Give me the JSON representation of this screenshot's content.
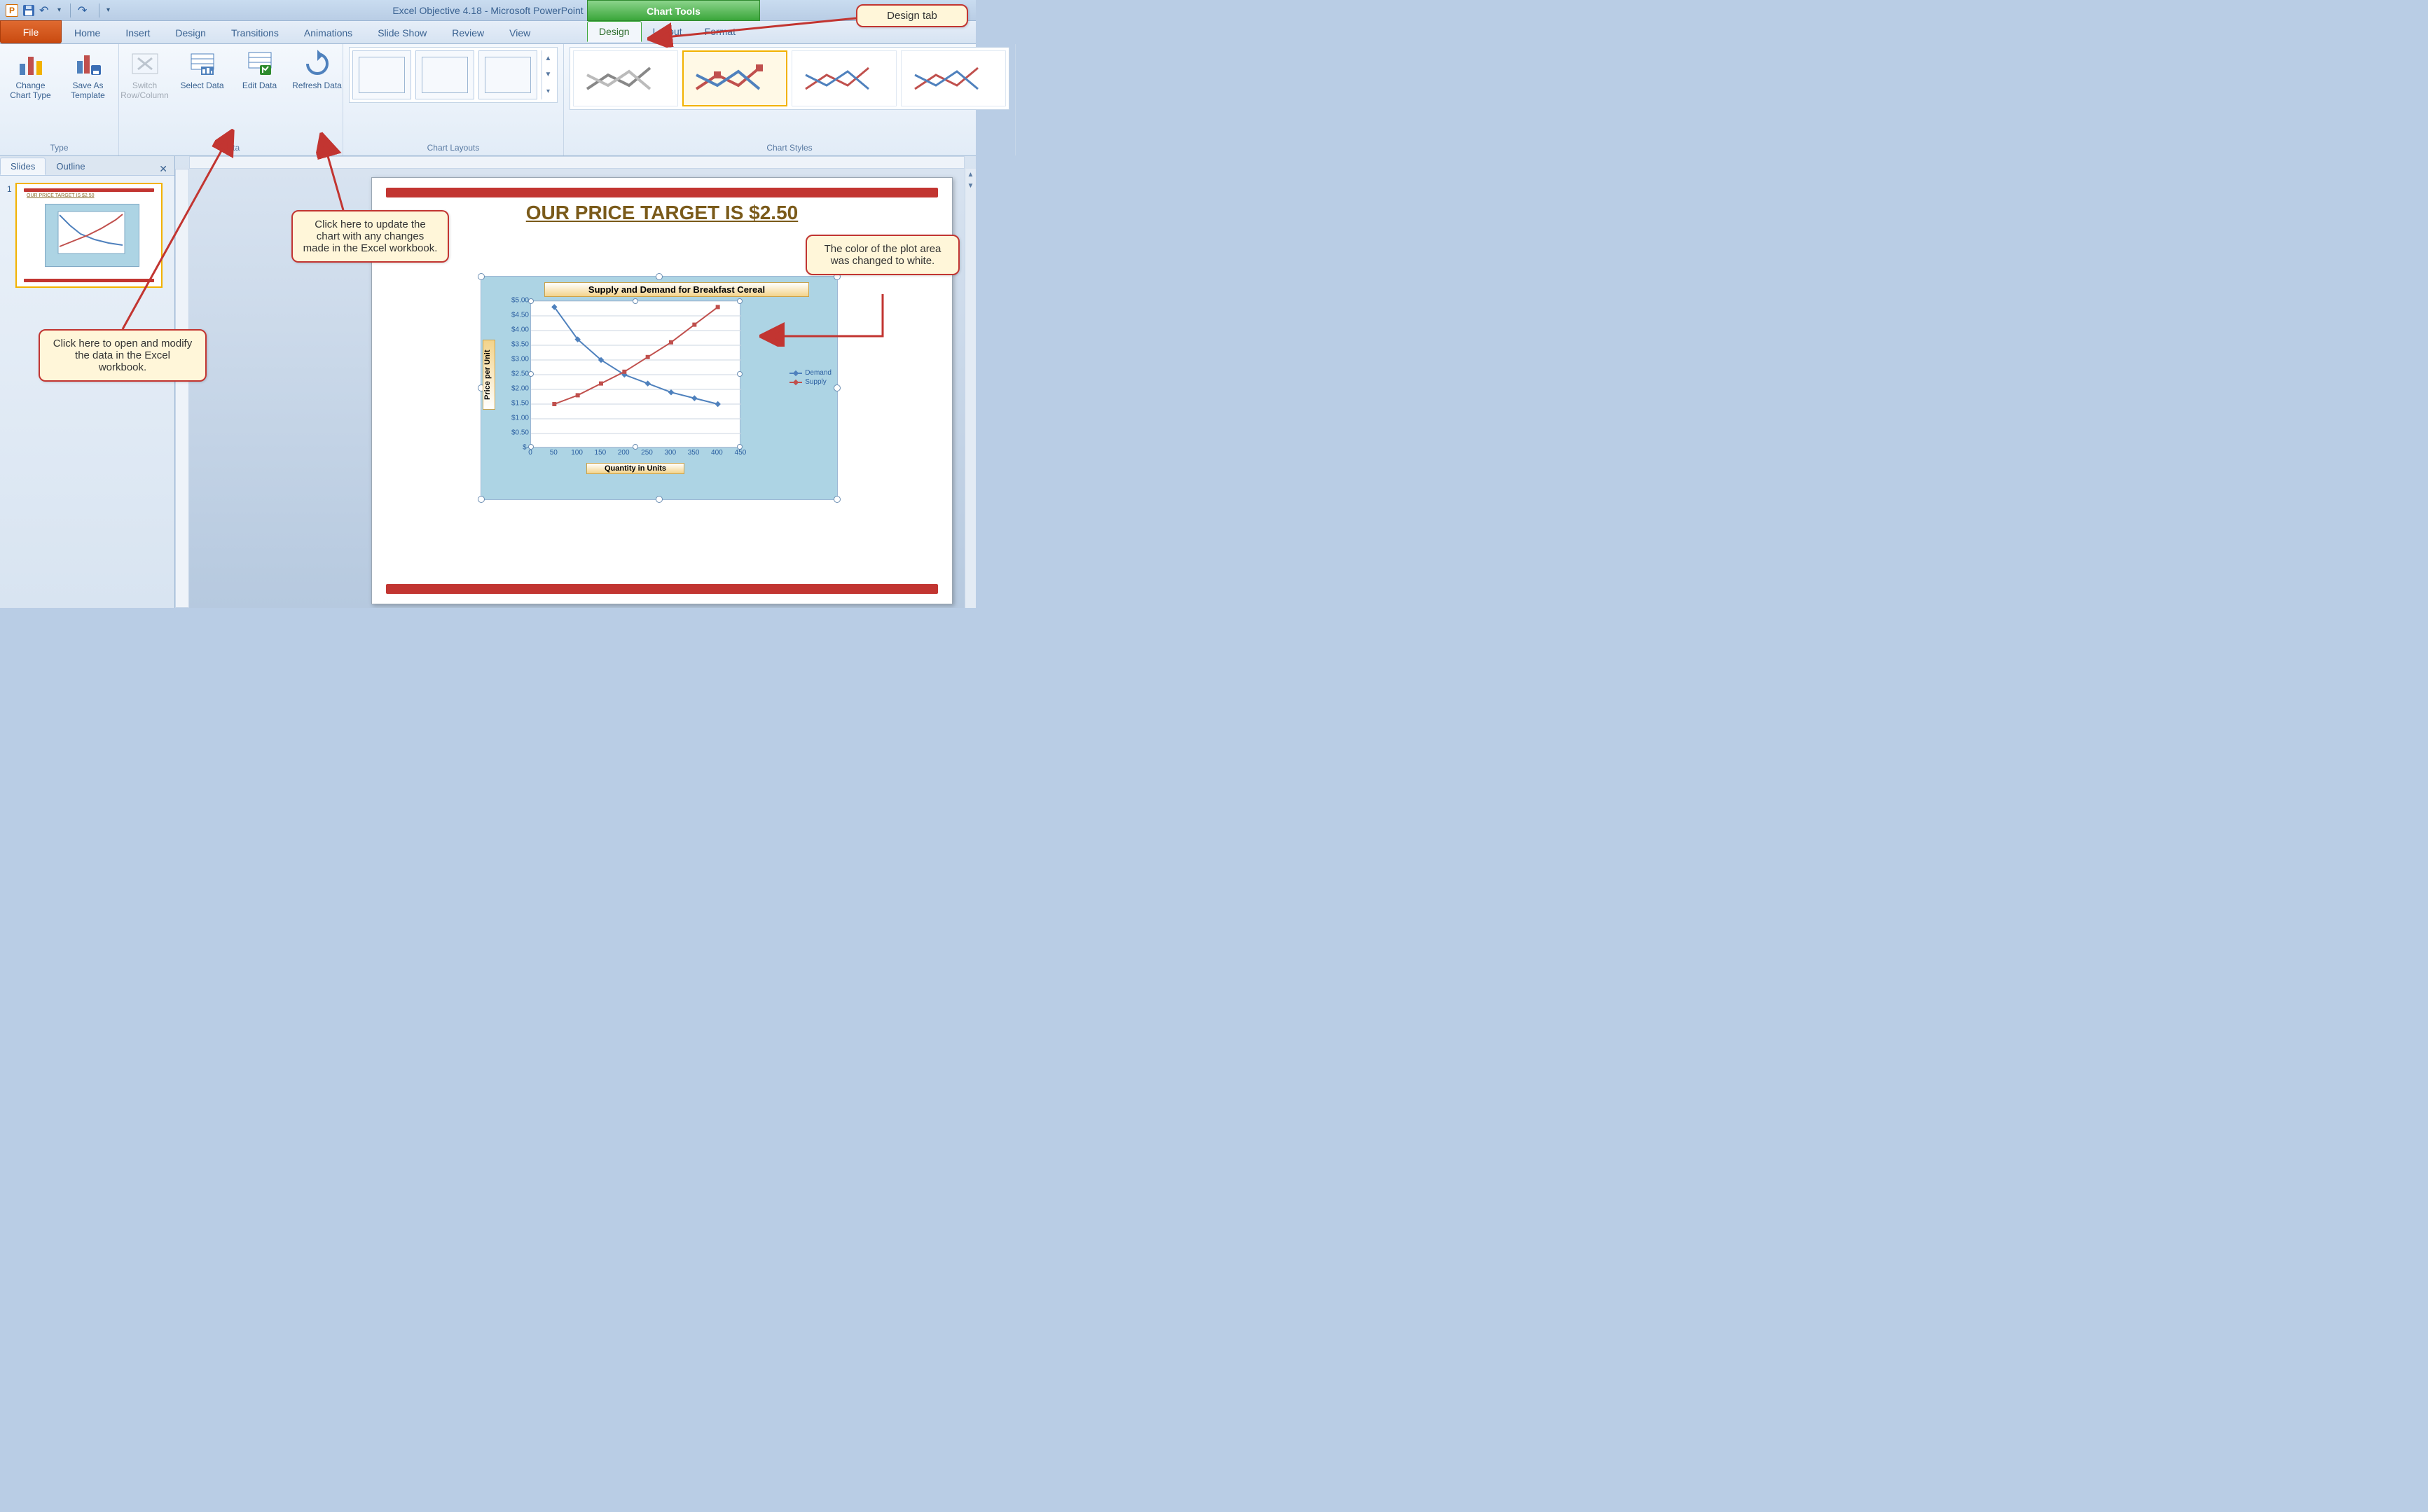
{
  "title": "Excel Objective 4.18 - Microsoft PowerPoint",
  "chart_tools_label": "Chart Tools",
  "file_tab": "File",
  "tabs": [
    "Home",
    "Insert",
    "Design",
    "Transitions",
    "Animations",
    "Slide Show",
    "Review",
    "View"
  ],
  "context_tabs": {
    "design": "Design",
    "layout": "Layout",
    "format": "Format"
  },
  "ribbon": {
    "type": {
      "label": "Type",
      "change_chart_type": "Change Chart Type",
      "save_as_template": "Save As Template"
    },
    "data": {
      "label": "Data",
      "switch": "Switch Row/Column",
      "select": "Select Data",
      "edit": "Edit Data",
      "refresh": "Refresh Data"
    },
    "chart_layouts": "Chart Layouts",
    "chart_styles": "Chart Styles"
  },
  "leftpane": {
    "slides": "Slides",
    "outline": "Outline",
    "slide_num": "1"
  },
  "slide": {
    "headline": "OUR PRICE TARGET IS $2.50"
  },
  "chart": {
    "title": "Supply and Demand for Breakfast Cereal",
    "ylabel": "Price per Unit",
    "xlabel": "Quantity in Units",
    "legend": {
      "demand": "Demand",
      "supply": "Supply"
    },
    "yticks": [
      "$5.00",
      "$4.50",
      "$4.00",
      "$3.50",
      "$3.00",
      "$2.50",
      "$2.00",
      "$1.50",
      "$1.00",
      "$0.50",
      "$-"
    ],
    "xticks": [
      "0",
      "50",
      "100",
      "150",
      "200",
      "250",
      "300",
      "350",
      "400",
      "450"
    ]
  },
  "callouts": {
    "design_tab": "Design tab",
    "refresh": "Click here to update the chart with any changes made in the Excel workbook.",
    "edit": "Click here to open and modify the data in the Excel workbook.",
    "plotarea": "The color of the plot area was changed to white."
  },
  "chart_data": {
    "type": "line",
    "title": "Supply and Demand for Breakfast Cereal",
    "xlabel": "Quantity in Units",
    "ylabel": "Price per Unit",
    "xlim": [
      0,
      450
    ],
    "ylim": [
      0,
      5.0
    ],
    "x": [
      50,
      100,
      150,
      200,
      250,
      300,
      350,
      400
    ],
    "series": [
      {
        "name": "Demand",
        "values": [
          4.8,
          3.7,
          3.0,
          2.5,
          2.2,
          1.9,
          1.7,
          1.5
        ]
      },
      {
        "name": "Supply",
        "values": [
          1.5,
          1.8,
          2.2,
          2.6,
          3.1,
          3.6,
          4.2,
          4.8
        ]
      }
    ],
    "grid": true,
    "legend_position": "right"
  }
}
